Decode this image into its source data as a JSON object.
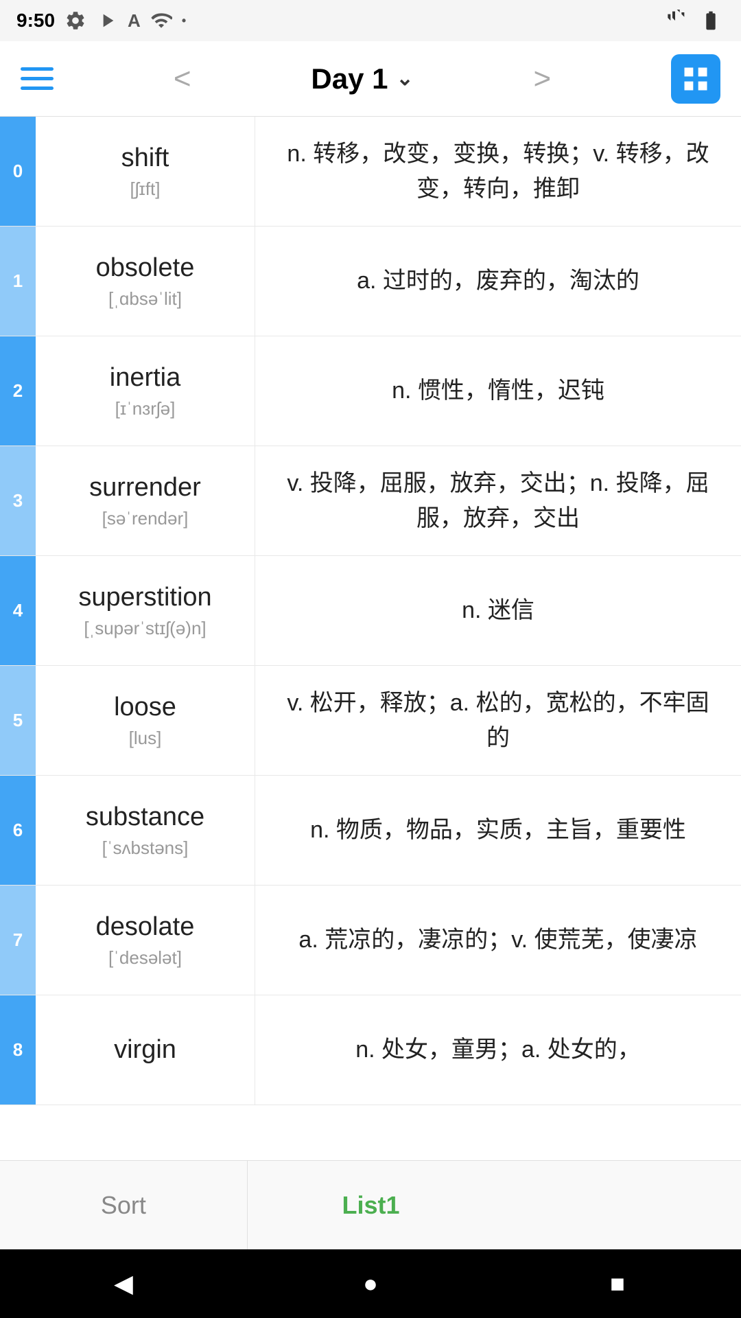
{
  "statusBar": {
    "time": "9:50",
    "icons": [
      "settings",
      "play",
      "A",
      "wifi",
      "battery"
    ]
  },
  "nav": {
    "title": "Day 1",
    "gridIcon": "grid-view",
    "prevArrow": "<",
    "nextArrow": ">"
  },
  "words": [
    {
      "index": "0",
      "indexLight": false,
      "word": "shift",
      "phonetic": "[ʃɪft]",
      "definition": "n. 转移，改变，变换，转换；v. 转移，改变，转向，推卸"
    },
    {
      "index": "1",
      "indexLight": true,
      "word": "obsolete",
      "phonetic": "[ˌɑbsəˈlit]",
      "definition": "a. 过时的，废弃的，淘汰的"
    },
    {
      "index": "2",
      "indexLight": false,
      "word": "inertia",
      "phonetic": "[ɪˈnɜrʃə]",
      "definition": "n. 惯性，惰性，迟钝"
    },
    {
      "index": "3",
      "indexLight": true,
      "word": "surrender",
      "phonetic": "[səˈrendər]",
      "definition": "v. 投降，屈服，放弃，交出；n. 投降，屈服，放弃，交出"
    },
    {
      "index": "4",
      "indexLight": false,
      "word": "superstition",
      "phonetic": "[ˌsupərˈstɪʃ(ə)n]",
      "definition": "n. 迷信"
    },
    {
      "index": "5",
      "indexLight": true,
      "word": "loose",
      "phonetic": "[lus]",
      "definition": "v. 松开，释放；a. 松的，宽松的，不牢固的"
    },
    {
      "index": "6",
      "indexLight": false,
      "word": "substance",
      "phonetic": "[ˈsʌbstəns]",
      "definition": "n. 物质，物品，实质，主旨，重要性"
    },
    {
      "index": "7",
      "indexLight": true,
      "word": "desolate",
      "phonetic": "[ˈdesələt]",
      "definition": "a. 荒凉的，凄凉的；v. 使荒芜，使凄凉"
    },
    {
      "index": "8",
      "indexLight": false,
      "word": "virgin",
      "phonetic": "",
      "definition": "n. 处女，童男；a. 处女的，"
    }
  ],
  "bottomTabs": {
    "sortLabel": "Sort",
    "list1Label": "List1"
  },
  "androidNav": {
    "back": "◀",
    "home": "●",
    "recent": "■"
  }
}
